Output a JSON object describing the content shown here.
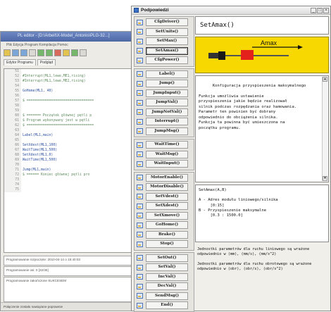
{
  "editor": {
    "title": "PL editor - [D:\\Arbeit\\X-Model_Antonis\\PLG-32...]",
    "menu": "Plik  Edycja  Program  Kompilacja  Pomoc",
    "tabs": [
      "Edytor Programu",
      "Podgląd"
    ],
    "code_lines": [
      {
        "num": "51",
        "text": ""
      },
      {
        "num": "52",
        "text": "#Interrupt(ML1,lewe,ME1,rising)"
      },
      {
        "num": "53",
        "text": "#Interrupt(ML1,lewe,ME2,rising)"
      },
      {
        "num": "54",
        "text": ""
      },
      {
        "num": "55",
        "text": "GoHome(ML1, 40)"
      },
      {
        "num": "56",
        "text": ""
      },
      {
        "num": "57",
        "text": "$ ================================="
      },
      {
        "num": "58",
        "text": ""
      },
      {
        "num": "59",
        "text": ""
      },
      {
        "num": "60",
        "text": "$ ======= Początek głównej pętli p"
      },
      {
        "num": "61",
        "text": "$ Program wykonywany jest w pętli"
      },
      {
        "num": "62",
        "text": "$ ================================="
      },
      {
        "num": "63",
        "text": ""
      },
      {
        "num": "64",
        "text": "Label(ML1,main)"
      },
      {
        "num": "65",
        "text": ""
      },
      {
        "num": "66",
        "text": "SetXdest(ML1,100)"
      },
      {
        "num": "67",
        "text": "WaitTime(ML1,500)"
      },
      {
        "num": "68",
        "text": "SetXdest(ML1,0)"
      },
      {
        "num": "69",
        "text": "WaitTime(ML1,500)"
      },
      {
        "num": "70",
        "text": ""
      },
      {
        "num": "71",
        "text": "Jump(ML1,main)"
      },
      {
        "num": "72",
        "text": "$ ====== Koniec głównej pętli pro"
      },
      {
        "num": "73",
        "text": ""
      },
      {
        "num": "74",
        "text": ""
      },
      {
        "num": "75",
        "text": ""
      }
    ],
    "status": [
      "Programowanie rozpoczęte: 2010-04-14 o 15:40:03",
      "Programowanie osi: 0   [32/36]",
      "Programowanie zakończone SUKCESEM"
    ],
    "bottom": "Połączenie zostało nawiązane poprawnie"
  },
  "help_window": {
    "title": "Podpowiedzi",
    "window_buttons": [
      "_",
      "□",
      "×"
    ],
    "groups": [
      [
        "CfgDriver()",
        "SetUnits()",
        "SetMax()",
        "SetAmax()",
        "CfgPower()"
      ],
      [
        "Label()",
        "Jump()",
        "JumpInput()",
        "JumpVal()",
        "JumpNotVal()",
        "Interrupt()",
        "JumpMsg()"
      ],
      [
        "WaitTime()",
        "WaitMsg()",
        "WaitInput()"
      ],
      [
        "MotorEnable()",
        "MotorDisable()",
        "SetVdest()",
        "SetXdest()",
        "SetXmove()",
        "GoHome()",
        "Brake()",
        "Stop()"
      ],
      [
        "SetOut()",
        "SetVal()",
        "IncVal()",
        "DecVal()",
        "SendMsg()",
        "End()"
      ]
    ],
    "selected": "SetAmax()",
    "function_title": "SetAmax()",
    "diagram_label": "Amax",
    "description": "Konfiguracja przyspieszenia maksymalnego\n\nFunkcja umożliwia ustawienie\nprzyspieszenia jakie będzie realizował\nsilnik podczas rozpędzania oraz hamowania.\nParametr ten powinien być dobrany\nodpowiednio do obciążenia silnika.\nFunkcja ta powinna być umieszczona na\npoczątku programu.",
    "syntax": "SetAmax(A,B)\n\nA - Adres modułu liniowego/silnika\n     [0:15]\nB - Przyspieszenie maksymalne\n     [0.3 : 1500.0]",
    "units": [
      "Jednostki parametrów dla ruchu liniowego są wrażone odpowiednio w (mm), (mm/s), (mm/s^2)",
      "Jednostki parametrów dla ruchu obrotowego są wrażone odpowiednio w (obr), (obr/s), (obr/s^2)"
    ],
    "colors": {
      "diagram_bg": "#f7d800",
      "diagram_accent": "#e3231b"
    }
  }
}
